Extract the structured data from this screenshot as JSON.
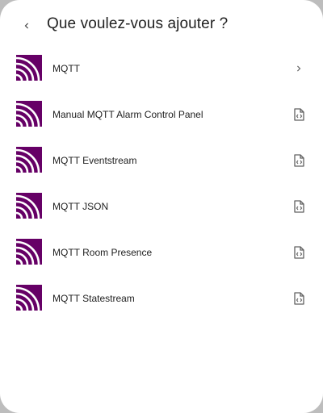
{
  "header": {
    "back_icon": "chevron-left-icon",
    "title": "Que voulez-vous ajouter ?"
  },
  "colors": {
    "brand": "#660066",
    "text": "#212121",
    "icon": "#616161",
    "background": "#ffffff"
  },
  "items": [
    {
      "label": "MQTT",
      "logo": "mqtt-logo",
      "trail_icon": "chevron-right-icon"
    },
    {
      "label": "Manual MQTT Alarm Control Panel",
      "logo": "mqtt-logo",
      "trail_icon": "file-code-icon"
    },
    {
      "label": "MQTT Eventstream",
      "logo": "mqtt-logo",
      "trail_icon": "file-code-icon"
    },
    {
      "label": "MQTT JSON",
      "logo": "mqtt-logo",
      "trail_icon": "file-code-icon"
    },
    {
      "label": "MQTT Room Presence",
      "logo": "mqtt-logo",
      "trail_icon": "file-code-icon"
    },
    {
      "label": "MQTT Statestream",
      "logo": "mqtt-logo",
      "trail_icon": "file-code-icon"
    }
  ]
}
